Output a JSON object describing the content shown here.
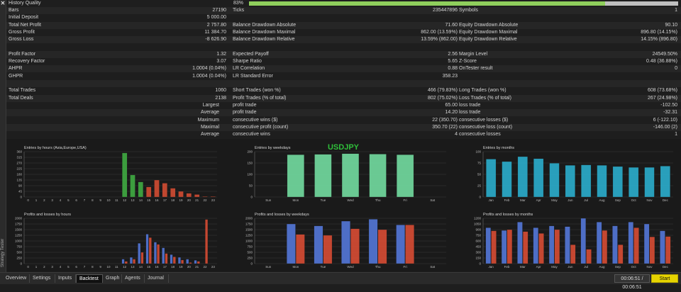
{
  "window": {
    "close_icon": "close-icon",
    "side_label": "Strategy Tester"
  },
  "report": {
    "history_quality": {
      "label": "History Quality",
      "value": "83%",
      "fill": 0.83
    },
    "rows": [
      {
        "shade": true,
        "c": [
          [
            "Bars",
            "27190"
          ],
          [
            "Ticks",
            "235447896"
          ],
          [
            "Symbols",
            "1"
          ]
        ]
      },
      {
        "shade": false,
        "c": [
          [
            "Initial Deposit",
            "5 000.00"
          ],
          [
            "",
            ""
          ],
          [
            "",
            ""
          ]
        ]
      },
      {
        "shade": true,
        "c": [
          [
            "Total Net Profit",
            "2 757.80"
          ],
          [
            "Balance Drawdown Absolute",
            "71.60"
          ],
          [
            "Equity Drawdown Absolute",
            "90.10"
          ]
        ]
      },
      {
        "shade": false,
        "c": [
          [
            "Gross Profit",
            "11 384.70"
          ],
          [
            "Balance Drawdown Maximal",
            "862.00 (13.59%)"
          ],
          [
            "Equity Drawdown Maximal",
            "896.80 (14.15%)"
          ]
        ]
      },
      {
        "shade": true,
        "c": [
          [
            "Gross Loss",
            "-8 626.90"
          ],
          [
            "Balance Drawdown Relative",
            "13.59% (862.00)"
          ],
          [
            "Equity Drawdown Relative",
            "14.15% (896.80)"
          ]
        ]
      },
      {
        "shade": false,
        "c": [
          [
            "",
            ""
          ],
          [
            "",
            ""
          ],
          [
            "",
            ""
          ]
        ]
      },
      {
        "shade": true,
        "c": [
          [
            "Profit Factor",
            "1.32"
          ],
          [
            "Expected Payoff",
            "2.56"
          ],
          [
            "Margin Level",
            "24549.50%"
          ]
        ]
      },
      {
        "shade": false,
        "c": [
          [
            "Recovery Factor",
            "3.07"
          ],
          [
            "Sharpe Ratio",
            "5.65"
          ],
          [
            "Z-Score",
            "0.48 (36.88%)"
          ]
        ]
      },
      {
        "shade": true,
        "c": [
          [
            "AHPR",
            "1.0004 (0.04%)"
          ],
          [
            "LR Correlation",
            "0.88"
          ],
          [
            "OnTester result",
            "0"
          ]
        ]
      },
      {
        "shade": false,
        "c": [
          [
            "GHPR",
            "1.0004 (0.04%)"
          ],
          [
            "LR Standard Error",
            "358.23"
          ],
          [
            "",
            ""
          ]
        ]
      },
      {
        "shade": true,
        "c": [
          [
            "",
            ""
          ],
          [
            "",
            ""
          ],
          [
            "",
            ""
          ]
        ]
      },
      {
        "shade": false,
        "c": [
          [
            "Total Trades",
            "1060"
          ],
          [
            "Short Trades (won %)",
            "466 (79.83%)"
          ],
          [
            "Long Trades (won %)",
            "608 (73.68%)"
          ]
        ]
      },
      {
        "shade": true,
        "c": [
          [
            "Total Deals",
            "2138"
          ],
          [
            "Profit Trades (% of total)",
            "802 (75.02%)"
          ],
          [
            "Loss Trades (% of total)",
            "267 (24.98%)"
          ]
        ]
      },
      {
        "shade": false,
        "r": true,
        "c": [
          [
            "Largest",
            ""
          ],
          [
            "profit trade",
            "65.00"
          ],
          [
            "loss trade",
            "-102.50"
          ]
        ]
      },
      {
        "shade": true,
        "r": true,
        "c": [
          [
            "Average",
            ""
          ],
          [
            "profit trade",
            "14.20"
          ],
          [
            "loss trade",
            "-32.31"
          ]
        ]
      },
      {
        "shade": false,
        "r": true,
        "c": [
          [
            "Maximum",
            ""
          ],
          [
            "consecutive wins ($)",
            "22 (350.70)"
          ],
          [
            "consecutive losses ($)",
            "6 (-122.10)"
          ]
        ]
      },
      {
        "shade": true,
        "r": true,
        "c": [
          [
            "Maximal",
            ""
          ],
          [
            "consecutive profit (count)",
            "350.70 (22)"
          ],
          [
            "consecutive loss (count)",
            "-146.00 (2)"
          ]
        ]
      },
      {
        "shade": false,
        "r": true,
        "c": [
          [
            "Average",
            ""
          ],
          [
            "consecutive wins",
            "4"
          ],
          [
            "consecutive losses",
            "1"
          ]
        ]
      }
    ]
  },
  "charts_panel": {
    "symbol": "USDJPY",
    "symbol_color": "#2fbf3a"
  },
  "chart_data": [
    {
      "type": "bar",
      "title": "Entries by hours (Asia,Europe,USA)",
      "categories": [
        "0",
        "1",
        "2",
        "3",
        "4",
        "5",
        "6",
        "7",
        "8",
        "9",
        "10",
        "11",
        "12",
        "13",
        "14",
        "15",
        "16",
        "17",
        "18",
        "19",
        "20",
        "21",
        "22",
        "23"
      ],
      "series": [
        {
          "values": [
            0,
            0,
            0,
            0,
            0,
            0,
            0,
            0,
            0,
            0,
            0,
            0,
            350,
            175,
            120,
            80,
            135,
            110,
            70,
            45,
            30,
            20,
            5,
            5
          ]
        }
      ],
      "colors": [
        "",
        "",
        "",
        "",
        "",
        "",
        "",
        "",
        "",
        "",
        "",
        "",
        "#3ea540",
        "#3ea540",
        "#3ea540",
        "#c94a32",
        "#c94a32",
        "#c94a32",
        "#c94a32",
        "#c94a32",
        "#c94a32",
        "#c94a32",
        "#c94a32",
        "#c94a32"
      ],
      "yticks": [
        "0",
        "45",
        "90",
        "135",
        "180",
        "225",
        "270",
        "315",
        "360"
      ],
      "ylim": [
        0,
        360
      ]
    },
    {
      "type": "bar",
      "title": "Entries by weekdays",
      "categories": [
        "Sun",
        "Mon",
        "Tue",
        "Wed",
        "Thu",
        "Fri",
        "Sat"
      ],
      "series": [
        {
          "values": [
            0,
            210,
            212,
            215,
            213,
            210,
            0
          ]
        }
      ],
      "colors": [
        "#6fd39a"
      ],
      "yticks": [
        "0",
        "50",
        "100",
        "150",
        "200"
      ],
      "ylim": [
        0,
        225
      ]
    },
    {
      "type": "bar",
      "title": "Entries by months",
      "categories": [
        "Jan",
        "Feb",
        "Mar",
        "Apr",
        "May",
        "Jun",
        "Jul",
        "Aug",
        "Sep",
        "Oct",
        "Nov",
        "Dec"
      ],
      "series": [
        {
          "values": [
            92,
            86,
            98,
            93,
            82,
            77,
            78,
            77,
            74,
            72,
            72,
            75
          ]
        }
      ],
      "colors": [
        "#2aa7c4"
      ],
      "yticks": [
        "0",
        "25",
        "50",
        "75",
        "100"
      ],
      "ylim": [
        0,
        110
      ]
    },
    {
      "type": "bar",
      "title": "Profits and losses by hours",
      "categories": [
        "0",
        "1",
        "2",
        "3",
        "4",
        "5",
        "6",
        "7",
        "8",
        "9",
        "10",
        "11",
        "12",
        "13",
        "14",
        "15",
        "16",
        "17",
        "18",
        "19",
        "20",
        "21",
        "22",
        "23"
      ],
      "series": [
        {
          "name": "profit",
          "values": [
            0,
            0,
            0,
            0,
            0,
            0,
            0,
            0,
            0,
            0,
            0,
            0,
            200,
            280,
            900,
            1300,
            950,
            700,
            400,
            280,
            200,
            150,
            0,
            0
          ]
        },
        {
          "name": "loss",
          "values": [
            0,
            0,
            0,
            0,
            0,
            0,
            0,
            0,
            0,
            0,
            0,
            0,
            100,
            200,
            500,
            1150,
            850,
            450,
            300,
            160,
            50,
            100,
            1950,
            0
          ]
        }
      ],
      "colors": [
        "#5173d0",
        "#cf4a33"
      ],
      "yticks": [
        "0",
        "250",
        "500",
        "750",
        "1000",
        "1250",
        "1500",
        "1750",
        "2000"
      ],
      "ylim": [
        0,
        2000
      ]
    },
    {
      "type": "bar",
      "title": "Profits and losses by weekdays",
      "categories": [
        "Sun",
        "Mon",
        "Tue",
        "Wed",
        "Thu",
        "Fri",
        "Sat"
      ],
      "series": [
        {
          "name": "profit",
          "values": [
            0,
            2100,
            2000,
            2250,
            2350,
            2050,
            0
          ]
        },
        {
          "name": "loss",
          "values": [
            0,
            1550,
            1500,
            1850,
            1800,
            2050,
            0
          ]
        }
      ],
      "colors": [
        "#5173d0",
        "#cf4a33"
      ],
      "yticks": [
        "0",
        "250",
        "500",
        "750",
        "1000",
        "1250",
        "1500",
        "1750",
        "2000"
      ],
      "ylim": [
        0,
        2400
      ]
    },
    {
      "type": "bar",
      "title": "Profits and losses by months",
      "categories": [
        "Jan",
        "Feb",
        "Mar",
        "Apr",
        "May",
        "Jun",
        "Jul",
        "Aug",
        "Sep",
        "Oct",
        "Nov",
        "Dec"
      ],
      "series": [
        {
          "name": "profit",
          "values": [
            950,
            880,
            1100,
            950,
            1000,
            980,
            1200,
            1100,
            1000,
            1100,
            1050,
            870
          ]
        },
        {
          "name": "loss",
          "values": [
            870,
            900,
            850,
            800,
            900,
            500,
            380,
            880,
            500,
            950,
            710,
            720
          ]
        }
      ],
      "colors": [
        "#5173d0",
        "#cf4a33"
      ],
      "yticks": [
        "0",
        "150",
        "300",
        "450",
        "600",
        "750",
        "900",
        "1050",
        "1200"
      ],
      "ylim": [
        0,
        1200
      ]
    }
  ],
  "bottom": {
    "tabs": [
      "Overview",
      "Settings",
      "Inputs",
      "Backtest",
      "Graph",
      "Agents",
      "Journal"
    ],
    "active": 3,
    "timer": "00:06:51 / 00:06:51",
    "start": "Start"
  }
}
